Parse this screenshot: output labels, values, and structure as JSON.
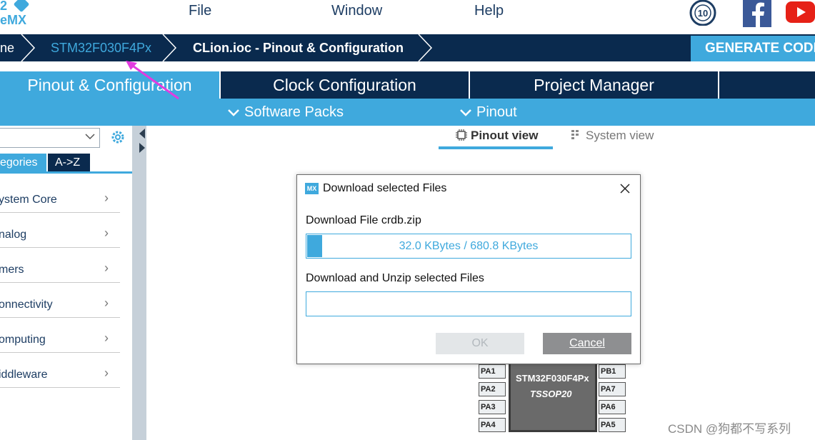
{
  "app": {
    "logo_line1": "2",
    "logo_line2": "eMX",
    "menu": [
      "File",
      "Window",
      "Help"
    ],
    "badge_number": "10"
  },
  "breadcrumb": {
    "items": [
      "ne",
      "STM32F030F4Px",
      "CLion.ioc - Pinout & Configuration"
    ],
    "generate_label": "GENERATE CODE"
  },
  "tabs": {
    "main": [
      "Pinout & Configuration",
      "Clock Configuration",
      "Project Manager"
    ],
    "sub": [
      "Software Packs",
      "Pinout"
    ]
  },
  "left_panel": {
    "category_tabs": [
      "egories",
      "A->Z"
    ],
    "categories": [
      "ystem Core",
      "nalog",
      "mers",
      "onnectivity",
      "omputing",
      "iddleware"
    ]
  },
  "views": {
    "pinout_view": "Pinout view",
    "system_view": "System view"
  },
  "chip": {
    "name": "STM32F030F4Px",
    "package": "TSSOP20",
    "left_pins": [
      "PA1",
      "PA2",
      "PA3",
      "PA4"
    ],
    "right_pins": [
      "PB1",
      "PA7",
      "PA6",
      "PA5"
    ]
  },
  "dialog": {
    "icon_text": "MX",
    "title": "Download selected Files",
    "label1": "Download File crdb.zip",
    "progress_text": "32.0 KBytes / 680.8 KBytes",
    "progress_fraction": 0.047,
    "label2": "Download and Unzip selected Files",
    "ok_label": "OK",
    "cancel_label": "Cancel"
  },
  "watermark": "CSDN @狗都不写系列",
  "colors": {
    "accent": "#3fa9dd",
    "navy": "#0a2a4e"
  }
}
